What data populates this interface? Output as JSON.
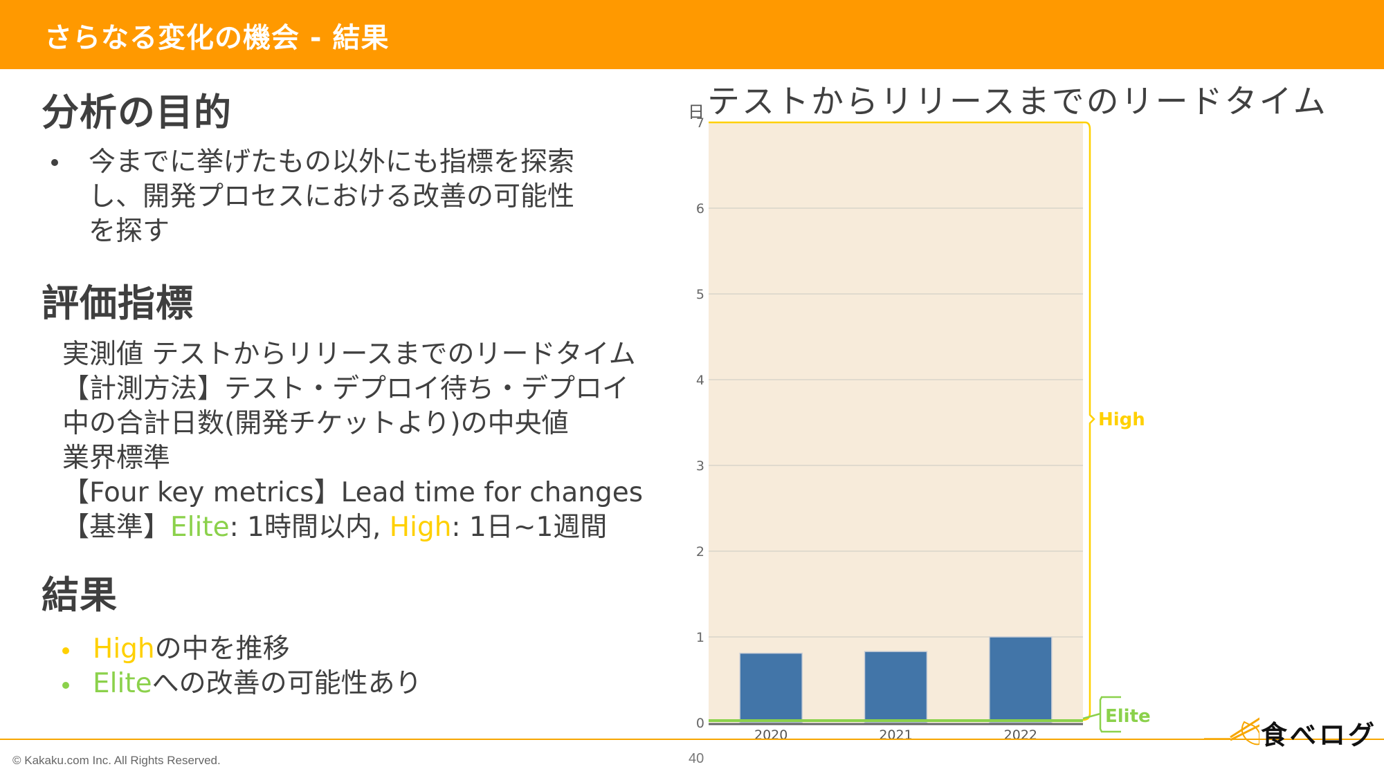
{
  "header": {
    "title": "さらなる変化の機会 - 結果"
  },
  "sections": {
    "purpose": {
      "heading": "分析の目的",
      "bullet_lines": [
        "今までに挙げたもの以外にも指標を探索",
        "し、開発プロセスにおける改善の可能性",
        "を探す"
      ]
    },
    "metrics": {
      "heading": "評価指標",
      "lines": [
        "実測値 テストからリリースまでのリードタイム",
        "【計測方法】テスト・デプロイ待ち・デプロイ",
        "中の合計日数(開発チケットより)の中央値",
        "業界標準",
        "【Four key metrics】Lead time for changes"
      ],
      "criteria": {
        "prefix": "【基準】",
        "elite_label": "Elite",
        "elite_text": ": 1時間以内, ",
        "high_label": "High",
        "high_text": ": 1日~1週間"
      }
    },
    "results": {
      "heading": "結果",
      "items": [
        {
          "highlight": "High",
          "text": "の中を推移",
          "color": "#FFD000"
        },
        {
          "highlight": "Elite",
          "text": "への改善の可能性あり",
          "color": "#8BD14B"
        }
      ]
    }
  },
  "colors": {
    "header": "#FF9900",
    "elite": "#8BD14B",
    "high": "#FFD000",
    "bar": "#4275A8",
    "plot_bg": "#F7EBDA"
  },
  "chart_data": {
    "type": "bar",
    "title": "テストからリリースまでのリードタイム",
    "ylabel": "日",
    "xlabel": "",
    "categories": [
      "2020",
      "2021",
      "2022"
    ],
    "values": [
      0.81,
      0.83,
      1.0
    ],
    "ylim": [
      0,
      7
    ],
    "yticks": [
      0,
      1,
      2,
      3,
      4,
      5,
      6,
      7
    ],
    "grid": true,
    "bands": [
      {
        "name": "High",
        "range": [
          0.04,
          7
        ]
      },
      {
        "name": "Elite",
        "range": [
          0,
          0.04
        ]
      }
    ]
  },
  "footer": {
    "copyright": "© Kakaku.com Inc. All Rights Reserved.",
    "page_number": "40",
    "logo_text": "食べログ"
  }
}
